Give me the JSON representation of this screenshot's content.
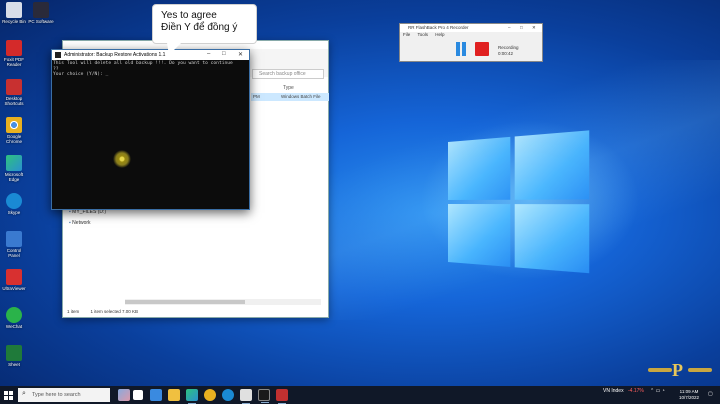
{
  "callout": {
    "line1": "Yes to agree",
    "line2": "Điền Y để đồng ý"
  },
  "terminal": {
    "title": "Administrator:  Backup Restore Activations 1.1",
    "lines": [
      "This Tool will delete all old backup !!!. Do you want to continue",
      "??",
      "Your choice (Y/N): _"
    ]
  },
  "explorer": {
    "search_placeholder": "Search backup office",
    "col_type": "Type",
    "row_time": "PM",
    "row_type": "Windows Batch File",
    "nav_items": [
      "MY_FILES (D:)",
      "Network"
    ],
    "status_count": "1 item",
    "status_selected": "1 item selected  7.00 KB"
  },
  "recorder": {
    "title": "RR FlashBack Pro 4 Recorder",
    "menu": [
      "File",
      "Tools",
      "Help"
    ],
    "status_label": "Recording",
    "elapsed": "0:00:42"
  },
  "desktop_icons": [
    {
      "label": "Recycle Bin",
      "color": "#d8dde8"
    },
    {
      "label": "PC Software",
      "color": "#2a2a3a"
    },
    {
      "label": "Foxit PDF Reader",
      "color": "#d42a2a"
    },
    {
      "label": "Desktop Shortcuts",
      "color": "#c83030"
    },
    {
      "label": "Google Chrome",
      "color": "#e8b020"
    },
    {
      "label": "Microsoft Edge",
      "color": "#2a90d0"
    },
    {
      "label": "Skype",
      "color": "#1a8ad4"
    },
    {
      "label": "Control Panel",
      "color": "#3a7ad0"
    },
    {
      "label": "UltraViewer",
      "color": "#d83030"
    },
    {
      "label": "WeChat",
      "color": "#2ab34a"
    },
    {
      "label": "Sheet",
      "color": "#1f7a3a"
    }
  ],
  "taskbar": {
    "search_placeholder": "Type here to search",
    "stock_name": "VN Index",
    "stock_change": "-4.17%",
    "time": "11:09 AM",
    "date": "10/7/2022"
  }
}
